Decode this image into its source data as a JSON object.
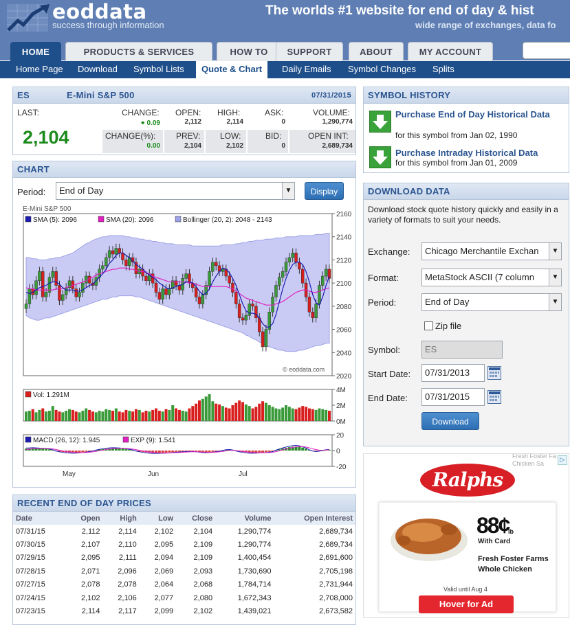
{
  "header": {
    "logo": "eoddata",
    "tagline": "success through information",
    "title": "The worlds #1 website for end of day & hist",
    "subtitle": "wide range of exchanges, data fo"
  },
  "main_tabs": [
    "HOME",
    "PRODUCTS & SERVICES",
    "HOW TO",
    "SUPPORT",
    "ABOUT",
    "MY ACCOUNT"
  ],
  "sub_nav": [
    "Home Page",
    "Download",
    "Symbol Lists",
    "Quote & Chart",
    "Daily Emails",
    "Symbol Changes",
    "Splits"
  ],
  "quote": {
    "symbol": "ES",
    "name": "E-Mini S&P 500",
    "date": "07/31/2015",
    "last_label": "LAST:",
    "last": "2,104",
    "change_label": "CHANGE:",
    "change": "0.09",
    "open_label": "OPEN:",
    "open": "2,112",
    "high_label": "HIGH:",
    "high": "2,114",
    "ask_label": "ASK:",
    "ask": "0",
    "volume_label": "VOLUME:",
    "volume": "1,290,774",
    "changepct_label": "CHANGE(%):",
    "changepct": "0.00",
    "prev_label": "PREV:",
    "prev": "2,104",
    "low_label": "LOW:",
    "low": "2,102",
    "bid_label": "BID:",
    "bid": "0",
    "openint_label": "OPEN INT:",
    "openint": "2,689,734"
  },
  "chart_panel": {
    "heading": "CHART",
    "period_label": "Period:",
    "period_value": "End of Day",
    "display_button": "Display"
  },
  "chart_data": [
    {
      "type": "candlestick",
      "title": "E-Mini S&P 500",
      "legend": [
        "SMA (5): 2096",
        "SMA (20): 2096",
        "Bollinger (20, 2): 2048 - 2143"
      ],
      "ylim": [
        2020,
        2160
      ],
      "yticks": [
        2020,
        2040,
        2060,
        2080,
        2100,
        2120,
        2140,
        2160
      ],
      "xticks": [
        "May",
        "Jun",
        "Jul"
      ],
      "watermark": "© eoddata.com",
      "closes": [
        2082,
        2095,
        2090,
        2102,
        2110,
        2088,
        2092,
        2105,
        2110,
        2098,
        2085,
        2090,
        2096,
        2102,
        2095,
        2088,
        2092,
        2100,
        2106,
        2100,
        2098,
        2105,
        2112,
        2115,
        2122,
        2128,
        2125,
        2130,
        2126,
        2120,
        2115,
        2122,
        2118,
        2108,
        2112,
        2106,
        2102,
        2108,
        2100,
        2092,
        2086,
        2095,
        2090,
        2095,
        2102,
        2098,
        2094,
        2104,
        2108,
        2100,
        2096,
        2088,
        2082,
        2090,
        2098,
        2110,
        2118,
        2115,
        2110,
        2112,
        2106,
        2100,
        2092,
        2082,
        2070,
        2068,
        2072,
        2082,
        2080,
        2070,
        2058,
        2045,
        2060,
        2075,
        2088,
        2098,
        2105,
        2110,
        2118,
        2122,
        2126,
        2118,
        2112,
        2100,
        2088,
        2075,
        2070,
        2082,
        2098,
        2106,
        2112,
        2104
      ],
      "sma5": [
        2092,
        2091,
        2092,
        2094,
        2096,
        2097,
        2098,
        2100,
        2101,
        2101,
        2099,
        2096,
        2094,
        2094,
        2094,
        2093,
        2093,
        2094,
        2096,
        2098,
        2099,
        2102,
        2105,
        2108,
        2112,
        2117,
        2120,
        2124,
        2126,
        2126,
        2124,
        2122,
        2119,
        2116,
        2114,
        2112,
        2109,
        2107,
        2105,
        2103,
        2100,
        2098,
        2096,
        2095,
        2096,
        2097,
        2098,
        2099,
        2101,
        2101,
        2100,
        2097,
        2093,
        2090,
        2091,
        2095,
        2101,
        2106,
        2110,
        2113,
        2112,
        2109,
        2104,
        2098,
        2090,
        2082,
        2076,
        2074,
        2074,
        2073,
        2070,
        2065,
        2062,
        2062,
        2065,
        2073,
        2084,
        2095,
        2104,
        2111,
        2116,
        2118,
        2118,
        2116,
        2110,
        2101,
        2090,
        2083,
        2081,
        2088,
        2098,
        2106
      ],
      "sma20": [
        2096,
        2095,
        2095,
        2094,
        2094,
        2094,
        2094,
        2094,
        2094,
        2095,
        2095,
        2095,
        2096,
        2097,
        2098,
        2099,
        2100,
        2101,
        2102,
        2104,
        2105,
        2107,
        2108,
        2109,
        2110,
        2111,
        2112,
        2112,
        2113,
        2113,
        2113,
        2112,
        2112,
        2111,
        2110,
        2110,
        2109,
        2108,
        2106,
        2105,
        2104,
        2103,
        2102,
        2101,
        2101,
        2101,
        2101,
        2101,
        2101,
        2100,
        2100,
        2099,
        2098,
        2097,
        2097,
        2097,
        2097,
        2097,
        2097,
        2097,
        2097,
        2096,
        2095,
        2093,
        2091,
        2089,
        2087,
        2086,
        2085,
        2084,
        2083,
        2082,
        2081,
        2081,
        2081,
        2082,
        2083,
        2084,
        2086,
        2088,
        2090,
        2092,
        2093,
        2094,
        2094,
        2093,
        2092,
        2092,
        2093,
        2094,
        2095,
        2096
      ],
      "bb_upper": [
        2122,
        2122,
        2121,
        2121,
        2120,
        2120,
        2120,
        2121,
        2121,
        2122,
        2122,
        2123,
        2124,
        2125,
        2126,
        2128,
        2130,
        2132,
        2134,
        2135,
        2137,
        2138,
        2139,
        2140,
        2140,
        2141,
        2141,
        2141,
        2141,
        2141,
        2140,
        2140,
        2139,
        2139,
        2138,
        2138,
        2137,
        2137,
        2136,
        2136,
        2135,
        2135,
        2134,
        2134,
        2134,
        2133,
        2133,
        2133,
        2133,
        2133,
        2132,
        2132,
        2132,
        2132,
        2132,
        2132,
        2132,
        2132,
        2132,
        2133,
        2133,
        2133,
        2133,
        2134,
        2134,
        2135,
        2135,
        2136,
        2136,
        2137,
        2137,
        2137,
        2138,
        2138,
        2138,
        2139,
        2139,
        2139,
        2140,
        2140,
        2140,
        2140,
        2141,
        2141,
        2141,
        2141,
        2141,
        2142,
        2142,
        2142,
        2143,
        2143
      ],
      "bb_lower": [
        2072,
        2070,
        2069,
        2068,
        2068,
        2069,
        2070,
        2070,
        2071,
        2072,
        2073,
        2074,
        2075,
        2076,
        2077,
        2078,
        2079,
        2080,
        2081,
        2082,
        2083,
        2084,
        2085,
        2086,
        2086,
        2087,
        2088,
        2088,
        2089,
        2089,
        2089,
        2089,
        2089,
        2088,
        2088,
        2087,
        2086,
        2085,
        2084,
        2083,
        2082,
        2081,
        2080,
        2079,
        2078,
        2077,
        2076,
        2075,
        2074,
        2073,
        2072,
        2071,
        2070,
        2069,
        2068,
        2067,
        2066,
        2065,
        2064,
        2063,
        2062,
        2061,
        2060,
        2059,
        2058,
        2057,
        2055,
        2054,
        2052,
        2051,
        2049,
        2048,
        2046,
        2045,
        2044,
        2043,
        2042,
        2042,
        2041,
        2041,
        2041,
        2041,
        2042,
        2042,
        2043,
        2044,
        2045,
        2046,
        2046,
        2047,
        2048,
        2048
      ]
    },
    {
      "type": "bar",
      "title": "Vol: 1.291M",
      "ylim": [
        0,
        4
      ],
      "yticks": [
        "4M",
        "2M",
        "0M"
      ],
      "values": [
        1.2,
        1.3,
        1.5,
        1.1,
        1.4,
        1.6,
        1.2,
        1.3,
        1.9,
        1.4,
        1.2,
        1.1,
        1.3,
        1.5,
        1.4,
        1.2,
        1.1,
        1.3,
        1.6,
        1.4,
        1.2,
        1.1,
        1.3,
        1.2,
        1.5,
        1.4,
        1.3,
        1.6,
        1.2,
        1.1,
        1.4,
        1.3,
        1.2,
        1.5,
        1.4,
        1.1,
        1.3,
        1.2,
        1.4,
        1.6,
        1.3,
        1.2,
        1.5,
        1.4,
        2.0,
        1.6,
        1.4,
        1.3,
        1.2,
        1.6,
        1.9,
        2.2,
        2.6,
        2.8,
        3.1,
        3.4,
        2.5,
        2.2,
        2.1,
        1.9,
        1.7,
        1.6,
        2.0,
        2.3,
        2.6,
        2.4,
        2.1,
        1.9,
        1.6,
        1.8,
        2.2,
        2.5,
        2.3,
        2.0,
        1.8,
        1.6,
        1.5,
        1.7,
        2.0,
        1.8,
        1.6,
        1.5,
        1.7,
        1.9,
        1.8,
        1.6,
        1.5,
        1.4,
        1.6,
        1.5,
        1.4,
        1.3
      ]
    },
    {
      "type": "bar",
      "title": "MACD (26, 12): 1.945",
      "legend": [
        "EXP (9): 1.541"
      ],
      "ylim": [
        -20,
        20
      ],
      "yticks": [
        20,
        0,
        -20
      ],
      "macd": [
        0,
        0,
        0,
        0,
        0,
        0,
        0,
        0,
        0,
        0,
        0,
        0,
        0,
        0,
        0,
        0,
        0,
        0,
        0,
        0,
        0,
        0,
        0,
        0,
        0,
        0,
        0,
        0,
        0,
        0,
        0,
        0,
        0,
        0,
        0,
        0,
        0,
        0,
        0,
        0,
        0,
        0,
        0,
        0,
        0,
        0,
        0,
        0,
        0,
        0,
        0,
        0,
        0,
        0,
        0,
        0,
        0,
        0,
        0,
        0,
        0,
        0,
        0,
        0,
        0,
        0,
        0,
        0,
        0,
        0,
        0,
        0,
        0,
        0,
        0,
        0,
        0,
        0,
        0,
        0,
        0,
        0,
        0,
        0,
        0,
        0,
        0,
        0,
        0,
        0,
        0,
        2
      ],
      "exp": [
        0,
        0,
        0,
        0,
        0,
        0,
        0,
        0,
        0,
        0,
        0,
        0,
        0,
        0,
        0,
        0,
        0,
        0,
        0,
        0,
        0,
        0,
        0,
        0,
        0,
        0,
        0,
        0,
        0,
        0,
        0,
        0,
        0,
        0,
        0,
        0,
        0,
        0,
        0,
        0,
        0,
        0,
        0,
        0,
        0,
        0,
        0,
        0,
        0,
        0,
        0,
        0,
        0,
        0,
        0,
        0,
        0,
        0,
        0,
        0,
        0,
        0,
        0,
        0,
        0,
        0,
        0,
        0,
        0,
        0,
        0,
        0,
        0,
        0,
        0,
        0,
        0,
        0,
        0,
        0,
        0,
        0,
        0,
        0,
        0,
        0,
        0,
        0,
        0,
        0,
        0,
        1.5
      ],
      "hist": [
        2.5,
        2.6,
        2.8,
        2.6,
        2.4,
        2.3,
        2.1,
        1.5,
        0.8,
        -0.5,
        -1.2,
        -1.8,
        -2.2,
        -2.4,
        -2.6,
        -2.5,
        -2.3,
        -2.0,
        -1.6,
        -1.0,
        -0.4,
        0.5,
        1.2,
        1.8,
        2.3,
        2.6,
        2.8,
        2.7,
        2.5,
        2.2,
        1.8,
        1.2,
        0.6,
        -0.5,
        -1.2,
        -1.8,
        -2.3,
        -2.6,
        -2.8,
        -2.8,
        -2.7,
        -2.6,
        -2.5,
        -2.3,
        -2.0,
        -1.7,
        -1.4,
        -1.2,
        -1.0,
        -0.8,
        -0.9,
        -1.2,
        -1.6,
        -2.0,
        -2.2,
        -2.0,
        -1.6,
        -1.2,
        -0.6,
        0.2,
        0.8,
        1.0,
        0.6,
        -0.4,
        -1.2,
        -1.8,
        -2.3,
        -2.6,
        -2.6,
        -2.5,
        -2.3,
        -2.2,
        -2.0,
        -1.6,
        -1.0,
        0.4,
        1.5,
        2.6,
        3.4,
        4.2,
        4.8,
        5.0,
        4.6,
        3.8,
        2.4,
        0.8,
        -0.5,
        -1.0,
        -0.6,
        0.2,
        0.8,
        1.0
      ]
    }
  ],
  "prices": {
    "heading": "RECENT END OF DAY PRICES",
    "columns": [
      "Date",
      "Open",
      "High",
      "Low",
      "Close",
      "Volume",
      "Open Interest"
    ],
    "rows": [
      [
        "07/31/15",
        "2,112",
        "2,114",
        "2,102",
        "2,104",
        "1,290,774",
        "2,689,734"
      ],
      [
        "07/30/15",
        "2,107",
        "2,110",
        "2,095",
        "2,109",
        "1,290,774",
        "2,689,734"
      ],
      [
        "07/29/15",
        "2,095",
        "2,111",
        "2,094",
        "2,109",
        "1,400,454",
        "2,691,600"
      ],
      [
        "07/28/15",
        "2,071",
        "2,096",
        "2,069",
        "2,093",
        "1,730,690",
        "2,705,198"
      ],
      [
        "07/27/15",
        "2,078",
        "2,078",
        "2,064",
        "2,068",
        "1,784,714",
        "2,731,944"
      ],
      [
        "07/24/15",
        "2,102",
        "2,106",
        "2,077",
        "2,080",
        "1,672,343",
        "2,708,000"
      ],
      [
        "07/23/15",
        "2,114",
        "2,117",
        "2,099",
        "2,102",
        "1,439,021",
        "2,673,582"
      ]
    ]
  },
  "symbol_history": {
    "heading": "SYMBOL HISTORY",
    "items": [
      {
        "title": "Purchase End of Day Historical Data",
        "subtitle": "for this symbol from Jan 02, 1990"
      },
      {
        "title": "Purchase Intraday Historical Data",
        "subtitle": "for this symbol from Jan 01, 2009"
      }
    ]
  },
  "download": {
    "heading": "DOWNLOAD DATA",
    "description": "Download stock quote history quickly and easily in a variety of formats to suit your needs.",
    "exchange_label": "Exchange:",
    "exchange_value": "Chicago Merchantile Exchan",
    "format_label": "Format:",
    "format_value": "MetaStock ASCII (7 column",
    "period_label": "Period:",
    "period_value": "End of Day",
    "zip_label": "Zip file",
    "symbol_label": "Symbol:",
    "symbol_value": "ES",
    "start_label": "Start Date:",
    "start_value": "07/31/2013",
    "end_label": "End Date:",
    "end_value": "07/31/2015",
    "button": "Download"
  },
  "ad": {
    "top_text": "Fresh Foster Fa Chicken Sa",
    "brand": "Ralphs",
    "price": "88¢",
    "price_unit": "lb",
    "with_card": "With Card",
    "product": "Fresh Foster Farms Whole Chicken",
    "valid": "Valid until Aug 4",
    "button": "Hover for Ad",
    "colors": {
      "brand": "#d81f26",
      "accent": "#e4262e"
    }
  }
}
